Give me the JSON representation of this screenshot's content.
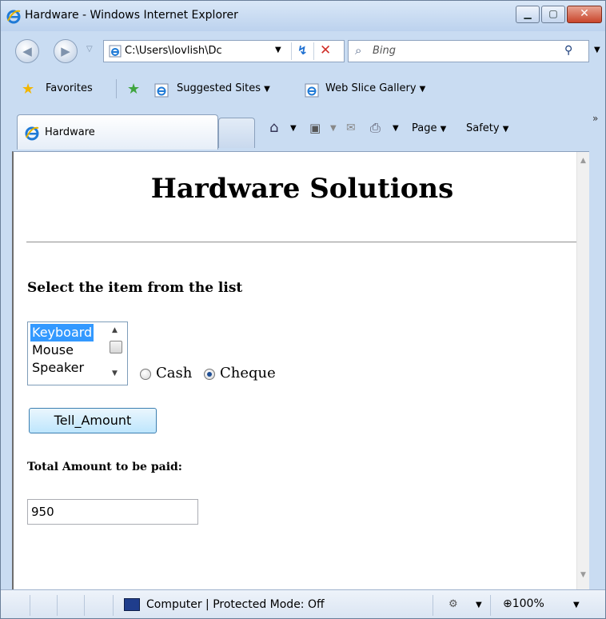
{
  "window": {
    "title": "Hardware - Windows Internet Explorer",
    "minimize_glyph": "▁",
    "maximize_glyph": "▢",
    "close_glyph": "✕"
  },
  "address_bar": {
    "url": "C:\\Users\\lovlish\\Dc",
    "icon": "ie-page-icon"
  },
  "search": {
    "placeholder": "Bing",
    "icon": "search-icon"
  },
  "favorites_bar": {
    "favorites_label": "Favorites",
    "suggested_sites_label": "Suggested Sites",
    "web_slice_label": "Web Slice Gallery"
  },
  "tab": {
    "label": "Hardware"
  },
  "command_bar": {
    "page_label": "Page",
    "safety_label": "Safety",
    "more_glyph": "»"
  },
  "page": {
    "title": "Hardware Solutions",
    "select_label": "Select the item from the list",
    "list_options": [
      "Keyboard",
      "Mouse",
      "Speaker"
    ],
    "selected_option": "Keyboard",
    "payment_options": [
      "Cash",
      "Cheque"
    ],
    "selected_payment": "Cheque",
    "button_label": "Tell_Amount",
    "total_label": "Total Amount to be paid:",
    "total_value": "950"
  },
  "status_bar": {
    "zone_text": "Computer | Protected Mode: Off",
    "zoom": "100%"
  },
  "colors": {
    "selection": "#3399ff",
    "chrome": "#c9dcf2",
    "close_button": "#c9452b"
  }
}
